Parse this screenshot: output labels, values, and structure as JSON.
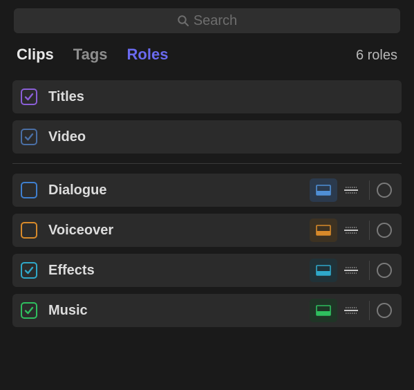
{
  "search": {
    "placeholder": "Search"
  },
  "tabs": {
    "clips": "Clips",
    "tags": "Tags",
    "roles": "Roles",
    "active": "roles"
  },
  "count_label": "6 roles",
  "video_roles": [
    {
      "label": "Titles",
      "color": "#8a5fd6",
      "checked": true
    },
    {
      "label": "Video",
      "color": "#4a6fa5",
      "checked": true
    }
  ],
  "audio_roles": [
    {
      "label": "Dialogue",
      "color": "#3f7fcf",
      "checked": false,
      "lane_active": true
    },
    {
      "label": "Voiceover",
      "color": "#d88a2a",
      "checked": false,
      "lane_active": true
    },
    {
      "label": "Effects",
      "color": "#2fa8c9",
      "checked": true,
      "lane_active": true
    },
    {
      "label": "Music",
      "color": "#2fbf5f",
      "checked": true,
      "lane_active": true
    }
  ]
}
